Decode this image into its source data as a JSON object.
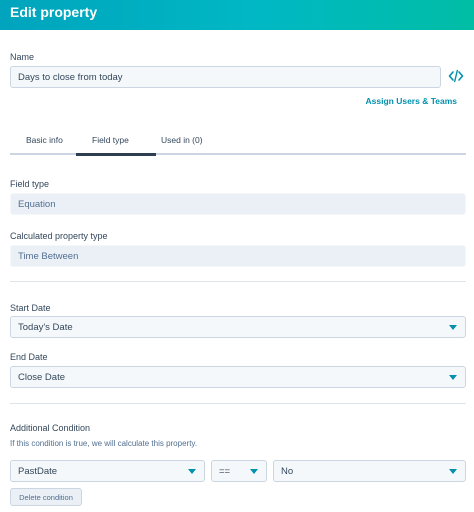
{
  "header": {
    "title": "Edit property"
  },
  "name_section": {
    "label": "Name",
    "value": "Days to close from today",
    "assign_link": "Assign Users & Teams"
  },
  "tabs": [
    {
      "label": "Basic info",
      "active": false
    },
    {
      "label": "Field type",
      "active": true
    },
    {
      "label": "Used in (0)",
      "active": false
    }
  ],
  "field_type": {
    "label": "Field type",
    "value": "Equation"
  },
  "calculated_type": {
    "label": "Calculated property type",
    "value": "Time Between"
  },
  "start_date": {
    "label": "Start Date",
    "value": "Today's Date"
  },
  "end_date": {
    "label": "End Date",
    "value": "Close Date"
  },
  "additional_condition": {
    "label": "Additional Condition",
    "hint": "If this condition is true, we will calculate this property.",
    "property": "PastDate",
    "operator": "==",
    "value": "No",
    "delete_label": "Delete condition"
  },
  "colors": {
    "header_gradient_start": "#00a4bd",
    "header_gradient_end": "#00bda5",
    "accent": "#0091ae",
    "text": "#33475b"
  }
}
